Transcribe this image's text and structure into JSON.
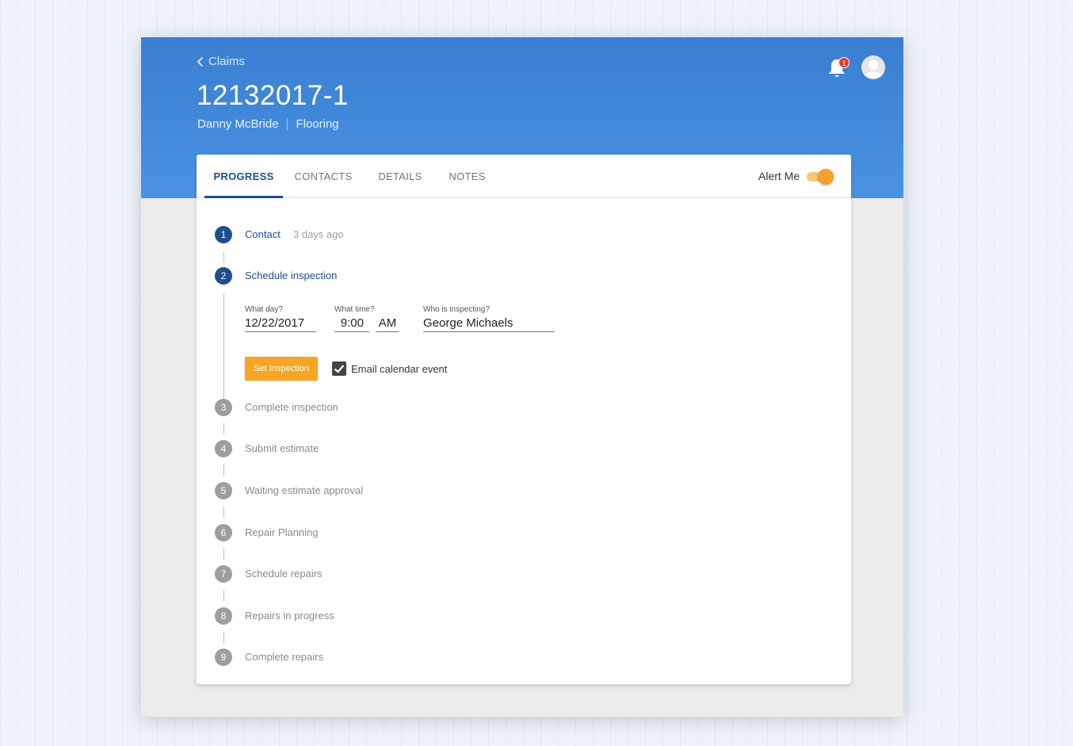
{
  "header": {
    "back_label": "Claims",
    "claim_number": "12132017-1",
    "customer": "Danny McBride",
    "category": "Flooring",
    "separator": "|",
    "notification_count": "1"
  },
  "tabs": [
    {
      "label": "PROGRESS"
    },
    {
      "label": "CONTACTS"
    },
    {
      "label": "DETAILS"
    },
    {
      "label": "NOTES"
    }
  ],
  "alert": {
    "label": "Alert Me",
    "enabled": true
  },
  "steps": [
    {
      "num": "1",
      "label": "Contact",
      "time": "3 days ago"
    },
    {
      "num": "2",
      "label": "Schedule inspection"
    },
    {
      "num": "3",
      "label": "Complete inspection"
    },
    {
      "num": "4",
      "label": "Submit estimate"
    },
    {
      "num": "5",
      "label": "Waiting estimate approval"
    },
    {
      "num": "6",
      "label": "Repair Planning"
    },
    {
      "num": "7",
      "label": "Schedule repairs"
    },
    {
      "num": "8",
      "label": "Repairs in progress"
    },
    {
      "num": "9",
      "label": "Complete repairs"
    }
  ],
  "inspection_form": {
    "day_label": "What day?",
    "day_value": "12/22/2017",
    "time_label": "What time?",
    "time_value": "9:00",
    "ampm_value": "AM",
    "inspector_label": "Who is inspecting?",
    "inspector_value": "George Michaels",
    "set_button": "Set Inspection",
    "email_label": "Email calendar event",
    "email_checked": true
  },
  "colors": {
    "header_blue": "#4a92e3",
    "active_blue": "#1f4e8f",
    "accent_orange": "#f5a623",
    "inactive_gray": "#9e9e9e"
  }
}
